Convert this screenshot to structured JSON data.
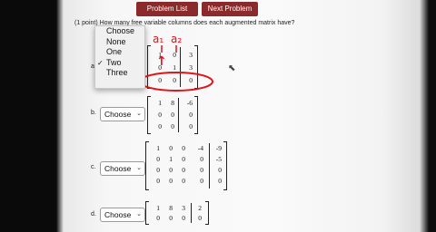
{
  "nav": {
    "problem_list": "Problem List",
    "next_problem": "Next Problem"
  },
  "question": {
    "text": "(1 point) How many free variable columns does each augmented matrix have?"
  },
  "dropdown": {
    "items": [
      {
        "label": "Choose",
        "checked": false
      },
      {
        "label": "None",
        "checked": false
      },
      {
        "label": "One",
        "checked": false
      },
      {
        "label": "Two",
        "checked": true
      },
      {
        "label": "Three",
        "checked": false
      }
    ],
    "check_mark": "✓"
  },
  "parts": [
    {
      "letter": "a.",
      "select_value": "Two",
      "matrix": [
        [
          "1",
          "0",
          "3"
        ],
        [
          "0",
          "1",
          "3"
        ],
        [
          "0",
          "0",
          "0"
        ]
      ]
    },
    {
      "letter": "b.",
      "select_value": "Choose",
      "matrix": [
        [
          "1",
          "8",
          "-6"
        ],
        [
          "0",
          "0",
          "0"
        ],
        [
          "0",
          "0",
          "0"
        ]
      ]
    },
    {
      "letter": "c.",
      "select_value": "Choose",
      "matrix": [
        [
          "1",
          "0",
          "0",
          "-4",
          "-9"
        ],
        [
          "0",
          "1",
          "0",
          "0",
          "-5"
        ],
        [
          "0",
          "0",
          "0",
          "0",
          "0"
        ],
        [
          "0",
          "0",
          "0",
          "0",
          "0"
        ]
      ]
    },
    {
      "letter": "d.",
      "select_value": "Choose",
      "matrix": [
        [
          "1",
          "8",
          "3",
          "2"
        ],
        [
          "0",
          "0",
          "0",
          "0"
        ]
      ]
    }
  ],
  "annotations": {
    "col_label_1": "a₁",
    "col_label_2": "a₂",
    "arrow": "↑"
  },
  "colors": {
    "nav_button": "#8b2a2a",
    "annotation_red": "#e0141c"
  }
}
